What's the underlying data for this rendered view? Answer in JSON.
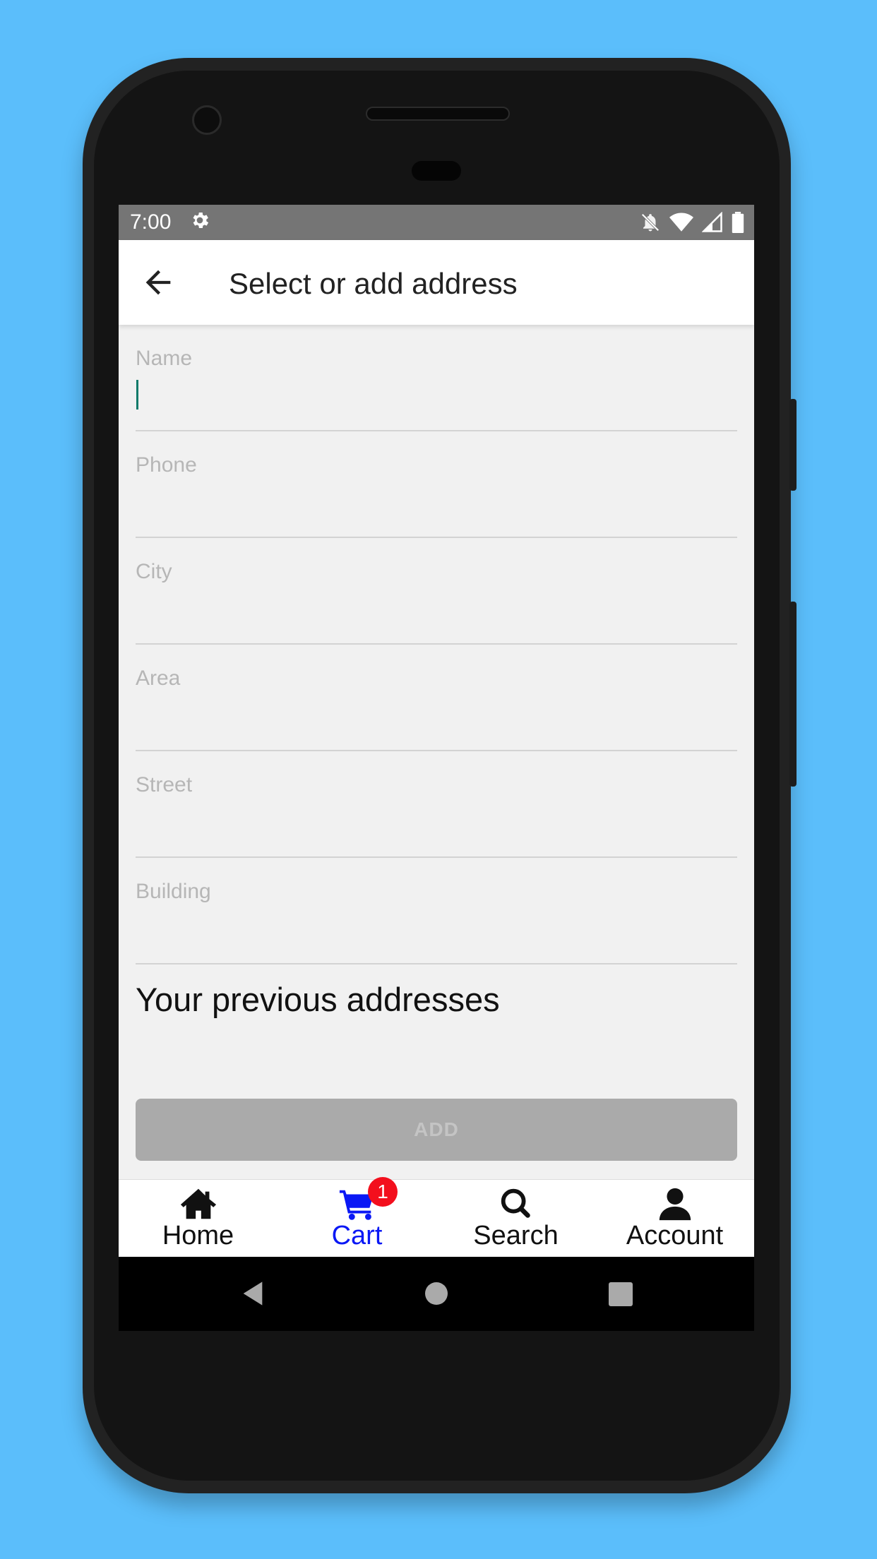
{
  "status_bar": {
    "time": "7:00"
  },
  "app_bar": {
    "title": "Select or add address"
  },
  "form": {
    "fields": [
      {
        "label": "Name"
      },
      {
        "label": "Phone"
      },
      {
        "label": "City"
      },
      {
        "label": "Area"
      },
      {
        "label": "Street"
      },
      {
        "label": "Building"
      }
    ]
  },
  "previous_addresses": {
    "title": "Your previous addresses"
  },
  "add_button": {
    "label": "ADD"
  },
  "bottom_nav": {
    "tabs": [
      {
        "label": "Home",
        "icon": "home-icon"
      },
      {
        "label": "Cart",
        "icon": "cart-icon",
        "badge": "1",
        "active": true
      },
      {
        "label": "Search",
        "icon": "search-icon"
      },
      {
        "label": "Account",
        "icon": "account-icon"
      }
    ]
  },
  "colors": {
    "background": "#5bbefb",
    "active_tab": "#0a18f5",
    "badge": "#f30f1d",
    "add_button": "#aaaaaa",
    "caret": "#0f7a6a"
  }
}
